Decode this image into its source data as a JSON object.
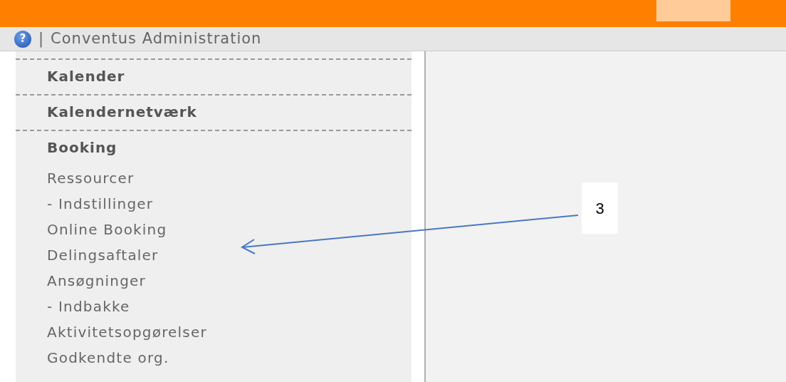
{
  "toolbar": {
    "help_icon": "?",
    "separator": "|",
    "title": "Conventus Administration"
  },
  "sections": [
    {
      "heading": "Kalender"
    },
    {
      "heading": "Kalendernetværk"
    },
    {
      "heading": "Booking",
      "items": [
        "Ressourcer",
        "- Indstillinger",
        "Online Booking",
        "Delingsaftaler",
        "Ansøgninger",
        "- Indbakke",
        "Aktivitetsopgørelser",
        "Godkendte org."
      ]
    }
  ],
  "annotation": {
    "label": "3"
  }
}
